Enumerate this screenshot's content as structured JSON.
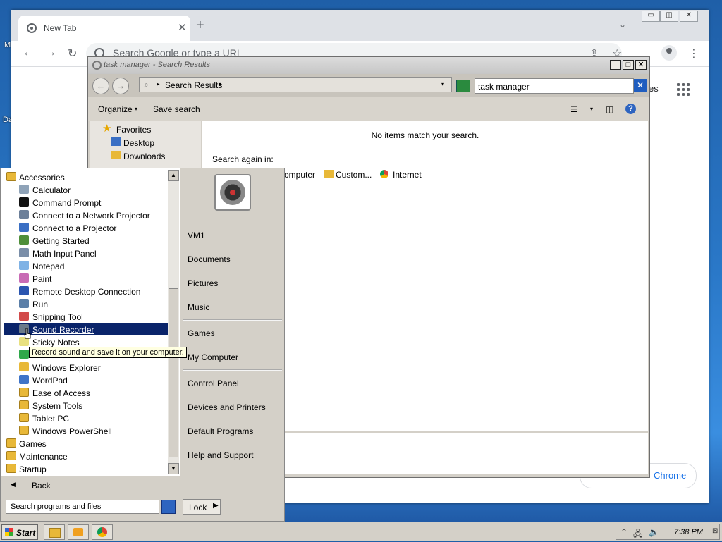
{
  "chrome": {
    "tab_title": "New Tab",
    "omnibox_placeholder": "Search Google or type a URL",
    "images_label": "es",
    "customize_label": "Chrome"
  },
  "explorer": {
    "title": "task manager - Search Results",
    "address": "Search Results",
    "search_value": "task manager",
    "organize_label": "Organize",
    "save_search_label": "Save search",
    "nav": {
      "favorites": "Favorites",
      "desktop": "Desktop",
      "downloads": "Downloads"
    },
    "no_items": "No items match your search.",
    "search_again": "Search again in:",
    "search_again_options": {
      "computer": "omputer",
      "custom": "Custom...",
      "internet": "Internet"
    }
  },
  "startmenu": {
    "programs": [
      {
        "label": "Accessories",
        "icon": "folder-icon",
        "top": true
      },
      {
        "label": "Calculator",
        "icon": "calculator-icon"
      },
      {
        "label": "Command Prompt",
        "icon": "command-prompt-icon"
      },
      {
        "label": "Connect to a Network Projector",
        "icon": "network-projector-icon"
      },
      {
        "label": "Connect to a Projector",
        "icon": "projector-icon"
      },
      {
        "label": "Getting Started",
        "icon": "getting-started-icon"
      },
      {
        "label": "Math Input Panel",
        "icon": "math-input-icon"
      },
      {
        "label": "Notepad",
        "icon": "notepad-icon"
      },
      {
        "label": "Paint",
        "icon": "paint-icon"
      },
      {
        "label": "Remote Desktop Connection",
        "icon": "remote-desktop-icon"
      },
      {
        "label": "Run",
        "icon": "run-icon"
      },
      {
        "label": "Snipping Tool",
        "icon": "snipping-tool-icon"
      },
      {
        "label": "Sound Recorder",
        "icon": "microphone-icon",
        "selected": true
      },
      {
        "label": "Sticky Notes",
        "icon": "sticky-notes-icon"
      },
      {
        "label": "",
        "icon": "sync-center-icon"
      },
      {
        "label": "Windows Explorer",
        "icon": "windows-explorer-icon"
      },
      {
        "label": "WordPad",
        "icon": "wordpad-icon"
      },
      {
        "label": "Ease of Access",
        "icon": "folder-icon"
      },
      {
        "label": "System Tools",
        "icon": "folder-icon"
      },
      {
        "label": "Tablet PC",
        "icon": "folder-icon"
      },
      {
        "label": "Windows PowerShell",
        "icon": "folder-icon"
      },
      {
        "label": "Games",
        "icon": "folder-icon",
        "top": true
      },
      {
        "label": "Maintenance",
        "icon": "folder-icon",
        "top": true
      },
      {
        "label": "Startup",
        "icon": "folder-icon",
        "top": true
      }
    ],
    "back_label": "Back",
    "search_placeholder": "Search programs and files",
    "lock_label": "Lock",
    "right_items": {
      "user": "VM1",
      "documents": "Documents",
      "pictures": "Pictures",
      "music": "Music",
      "games": "Games",
      "computer": "My Computer",
      "control_panel": "Control Panel",
      "devices": "Devices and Printers",
      "default_programs": "Default Programs",
      "help": "Help and Support"
    }
  },
  "tooltip": "Record sound and save it on your computer.",
  "taskbar": {
    "start_label": "Start",
    "clock": "7:38 PM"
  },
  "desktop": {
    "frag_m": "M",
    "frag_da": "Da"
  }
}
